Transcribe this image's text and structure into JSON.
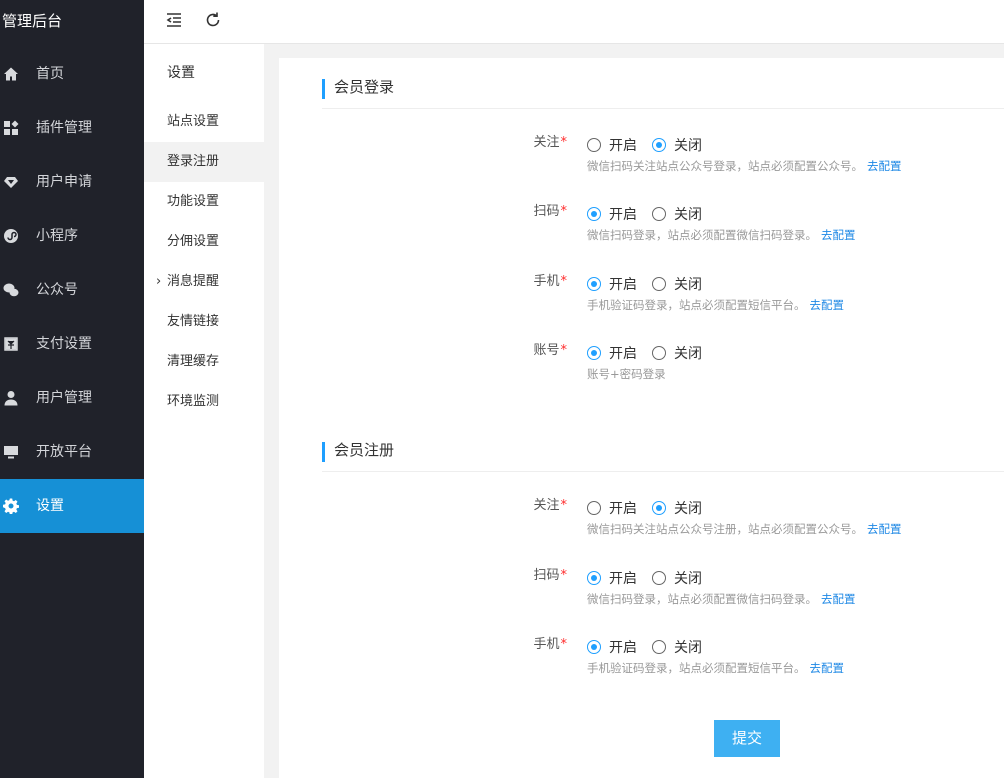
{
  "brand": "管理后台",
  "nav": [
    {
      "label": "首页",
      "icon": "home-icon"
    },
    {
      "label": "插件管理",
      "icon": "plugin-icon"
    },
    {
      "label": "用户申请",
      "icon": "diamond-icon"
    },
    {
      "label": "小程序",
      "icon": "mini-program-icon"
    },
    {
      "label": "公众号",
      "icon": "wechat-icon"
    },
    {
      "label": "支付设置",
      "icon": "payment-icon"
    },
    {
      "label": "用户管理",
      "icon": "user-icon"
    },
    {
      "label": "开放平台",
      "icon": "monitor-icon"
    },
    {
      "label": "设置",
      "icon": "gear-icon",
      "active": true
    }
  ],
  "submenu": {
    "title": "设置",
    "items": [
      {
        "label": "站点设置"
      },
      {
        "label": "登录注册",
        "active": true
      },
      {
        "label": "功能设置"
      },
      {
        "label": "分佣设置"
      },
      {
        "label": "消息提醒",
        "has_arrow": true
      },
      {
        "label": "友情链接"
      },
      {
        "label": "清理缓存"
      },
      {
        "label": "环境监测"
      }
    ]
  },
  "login": {
    "title": "会员登录",
    "rows": [
      {
        "label": "关注",
        "on": "开启",
        "off": "关闭",
        "value": "off",
        "hint": "微信扫码关注站点公众号登录，站点必须配置公众号。",
        "link": "去配置"
      },
      {
        "label": "扫码",
        "on": "开启",
        "off": "关闭",
        "value": "on",
        "hint": "微信扫码登录，站点必须配置微信扫码登录。",
        "link": "去配置"
      },
      {
        "label": "手机",
        "on": "开启",
        "off": "关闭",
        "value": "on",
        "hint": "手机验证码登录，站点必须配置短信平台。",
        "link": "去配置"
      },
      {
        "label": "账号",
        "on": "开启",
        "off": "关闭",
        "value": "on",
        "hint": "账号+密码登录",
        "link": ""
      }
    ]
  },
  "register": {
    "title": "会员注册",
    "rows": [
      {
        "label": "关注",
        "on": "开启",
        "off": "关闭",
        "value": "off",
        "hint": "微信扫码关注站点公众号注册，站点必须配置公众号。",
        "link": "去配置"
      },
      {
        "label": "扫码",
        "on": "开启",
        "off": "关闭",
        "value": "on",
        "hint": "微信扫码登录，站点必须配置微信扫码登录。",
        "link": "去配置"
      },
      {
        "label": "手机",
        "on": "开启",
        "off": "关闭",
        "value": "on",
        "hint": "手机验证码登录，站点必须配置短信平台。",
        "link": "去配置"
      }
    ]
  },
  "submit_label": "提交",
  "colors": {
    "accent": "#1e9fff",
    "sidebar_bg": "#20222a",
    "active_nav": "#1690d6",
    "required": "#ff2a2a",
    "link": "#1e88e5"
  }
}
